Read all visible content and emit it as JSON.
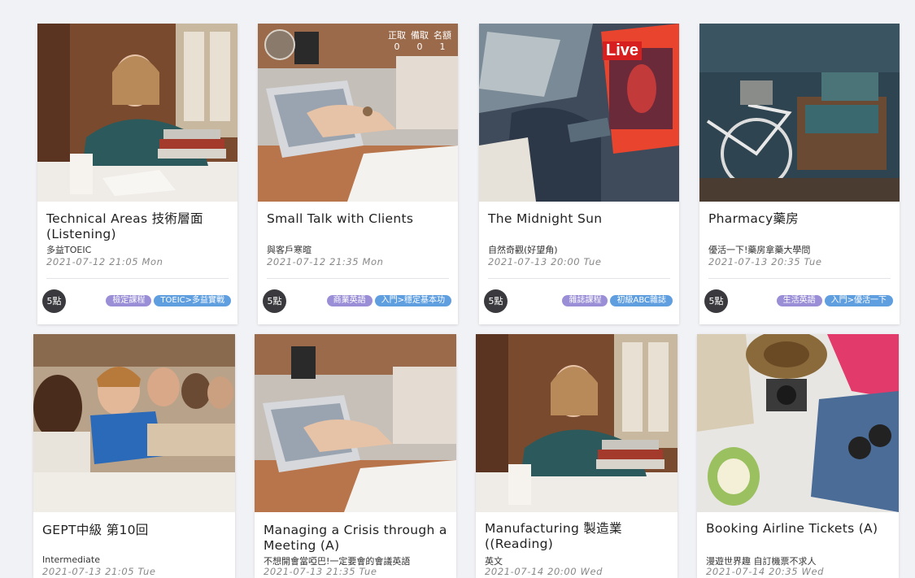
{
  "cards": [
    {
      "title": "Technical Areas 技術層面 (Listening)",
      "subtitle": "多益TOEIC",
      "datetime": "2021-07-12 21:05 Mon",
      "points": "5點",
      "tags": [
        "檢定課程",
        "TOEIC>多益實戰"
      ],
      "image_icon": "student-thinking-photo"
    },
    {
      "title": "Small Talk with Clients",
      "subtitle": "與客戶寒暄",
      "datetime": "2021-07-12 21:35 Mon",
      "points": "5點",
      "tags": [
        "商業英語",
        "入門>穩定基本功"
      ],
      "image_icon": "laptop-typing-photo",
      "stats": [
        {
          "label": "正取",
          "value": "0"
        },
        {
          "label": "備取",
          "value": "0"
        },
        {
          "label": "名額",
          "value": "1"
        }
      ]
    },
    {
      "title": "The Midnight Sun",
      "subtitle": "自然奇觀(好望角)",
      "datetime": "2021-07-13 20:00 Tue",
      "points": "5點",
      "tags": [
        "雜誌課程",
        "初級ABC雜誌"
      ],
      "image_icon": "magazines-photo",
      "magazine_logo": "Live"
    },
    {
      "title": "Pharmacy藥房",
      "subtitle": "優活一下!藥房拿藥大學問",
      "datetime": "2021-07-13 20:35 Tue",
      "points": "5點",
      "tags": [
        "生活英語",
        "入門>優活一下"
      ],
      "image_icon": "bicycle-luggage-photo"
    },
    {
      "title": "GEPT中級 第10回",
      "subtitle": "Intermediate",
      "datetime": "2021-07-13 21:05 Tue",
      "image_icon": "classroom-students-photo"
    },
    {
      "title": "Managing a Crisis through a Meeting (A)",
      "subtitle": "不想開會當啞巴!一定要會的會議英語",
      "datetime": "2021-07-13 21:35 Tue",
      "image_icon": "laptop-typing-photo"
    },
    {
      "title": "Manufacturing 製造業 ((Reading)",
      "subtitle": "英文",
      "datetime": "2021-07-14 20:00 Wed",
      "image_icon": "student-thinking-photo"
    },
    {
      "title": "Booking Airline Tickets (A)",
      "subtitle": "漫遊世界趣 自訂機票不求人",
      "datetime": "2021-07-14 20:35 Wed",
      "image_icon": "travel-flatlay-photo"
    }
  ],
  "colors": {
    "tag_purple": "#9a8fd6",
    "tag_blue": "#5f9fe0",
    "points_badge": "#3a3a3e",
    "page_bg": "#f1f2f6"
  }
}
